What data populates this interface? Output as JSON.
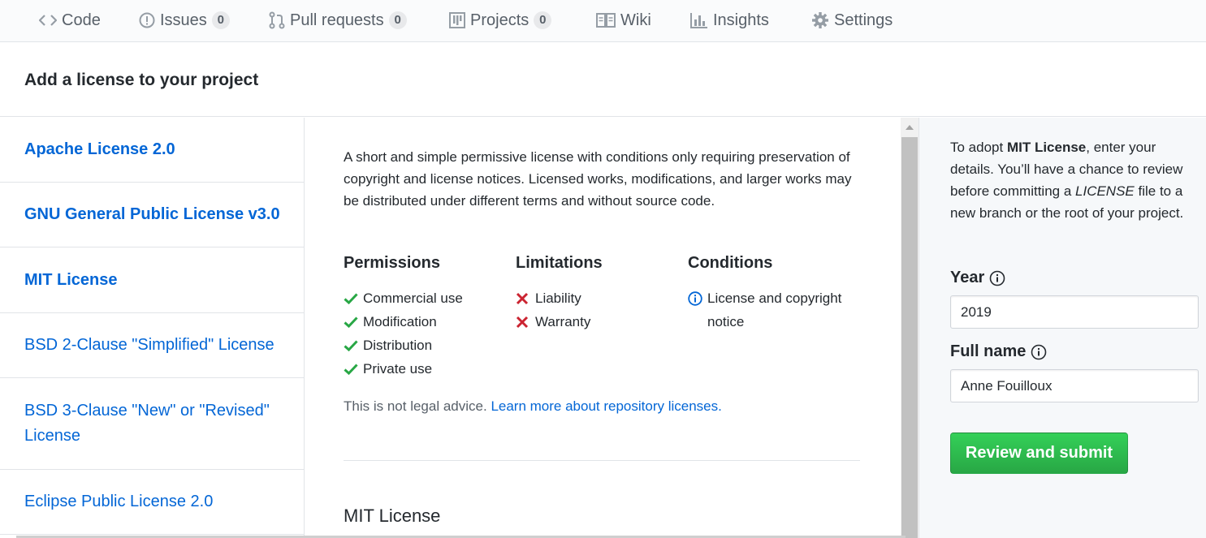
{
  "nav": {
    "tabs": [
      {
        "label": "Code",
        "icon": "code-icon"
      },
      {
        "label": "Issues",
        "icon": "issue-icon",
        "count": "0"
      },
      {
        "label": "Pull requests",
        "icon": "pull-request-icon",
        "count": "0"
      },
      {
        "label": "Projects",
        "icon": "project-icon",
        "count": "0"
      },
      {
        "label": "Wiki",
        "icon": "book-icon"
      },
      {
        "label": "Insights",
        "icon": "graph-icon"
      },
      {
        "label": "Settings",
        "icon": "gear-icon"
      }
    ]
  },
  "page": {
    "title": "Add a license to your project"
  },
  "licenses": [
    {
      "label": "Apache License 2.0"
    },
    {
      "label": "GNU General Public License v3.0"
    },
    {
      "label": "MIT License"
    },
    {
      "label": "BSD 2-Clause \"Simplified\" License"
    },
    {
      "label": "BSD 3-Clause \"New\" or \"Revised\" License"
    },
    {
      "label": "Eclipse Public License 2.0"
    }
  ],
  "description": {
    "text": "A short and simple permissive license with conditions only requiring preservation of copyright and license notices. Licensed works, modifications, and larger works may be distributed under different terms and without source code.",
    "permissions": {
      "heading": "Permissions",
      "items": [
        "Commercial use",
        "Modification",
        "Distribution",
        "Private use"
      ]
    },
    "limitations": {
      "heading": "Limitations",
      "items": [
        "Liability",
        "Warranty"
      ]
    },
    "conditions": {
      "heading": "Conditions",
      "items": [
        "License and copyright notice"
      ]
    },
    "legal_text": "This is not legal advice.",
    "legal_link": "Learn more about repository licenses.",
    "license_heading": "MIT License"
  },
  "form": {
    "intro_prefix": "To adopt ",
    "intro_license": "MIT License",
    "intro_middle": ", enter your details. You’ll have a chance to review before committing a ",
    "intro_file": "LICENSE",
    "intro_suffix": " file to a new branch or the root of your project.",
    "year_label": "Year",
    "year_value": "2019",
    "name_label": "Full name",
    "name_value": "Anne Fouilloux",
    "submit_label": "Review and submit"
  },
  "colors": {
    "link": "#0366d6",
    "check": "#28a745",
    "cross": "#cb2431",
    "info": "#0366d6",
    "button": "#28a745"
  }
}
